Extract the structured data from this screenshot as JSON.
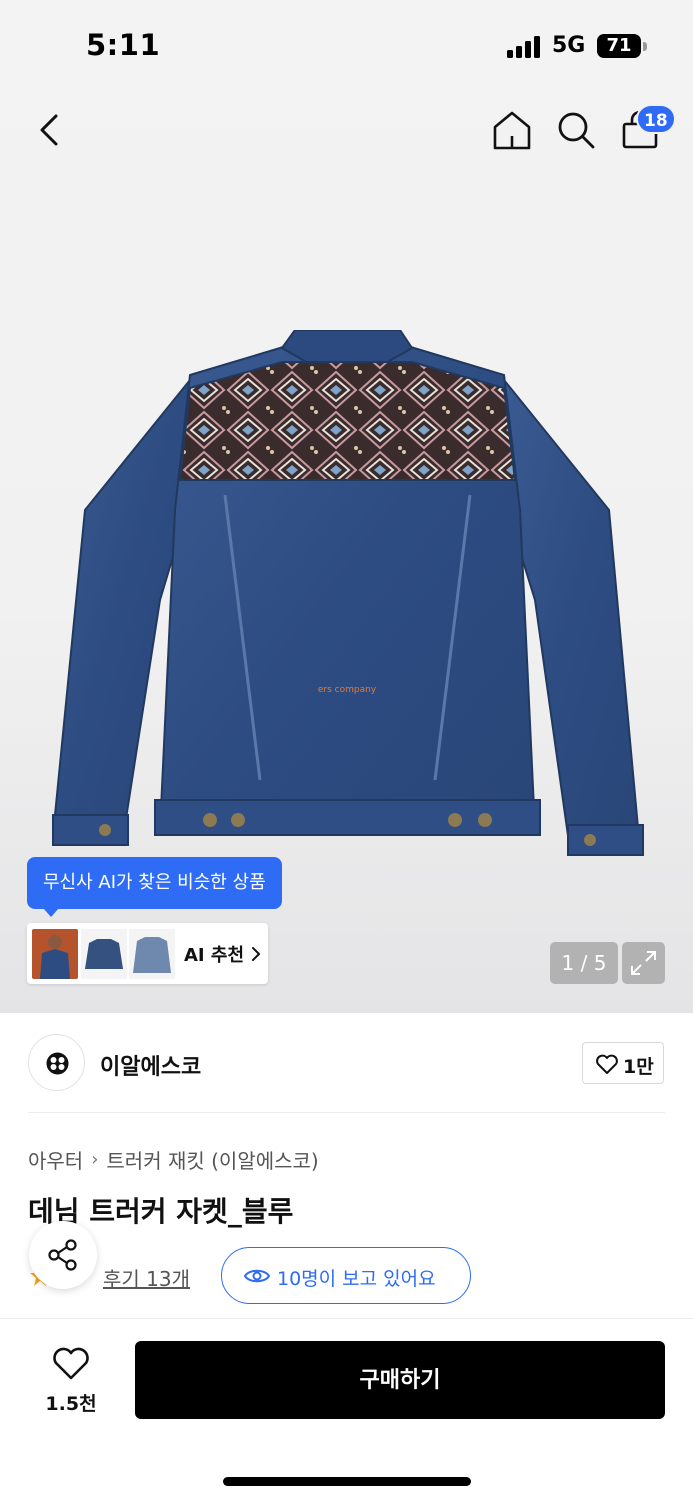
{
  "status_bar": {
    "time": "5:11",
    "network": "5G",
    "battery": "71"
  },
  "nav": {
    "back": "back-icon",
    "home": "home-icon",
    "search": "search-icon",
    "cart": "shopping-bag-icon",
    "cart_badge": "18"
  },
  "image": {
    "ai_tooltip": "무신사 AI가 찾은 비슷한 상품",
    "ai_recommend_label": "AI 추천",
    "pager": "1 / 5",
    "jacket_print": "ers company"
  },
  "brand": {
    "name": "이알에스코",
    "like_count": "1만"
  },
  "breadcrumb": {
    "category": "아우터",
    "subcategory": "트러커 재킷 (이알에스코)"
  },
  "product": {
    "title": "데님 트러커 자켓_블루",
    "reviews": "후기 13개",
    "viewers": "10명이 보고 있어요"
  },
  "bottom": {
    "wish_count": "1.5천",
    "buy_label": "구매하기"
  },
  "colors": {
    "accent": "#2e6cf6",
    "denim": "#2f4f85",
    "buy_button": "#000000"
  }
}
